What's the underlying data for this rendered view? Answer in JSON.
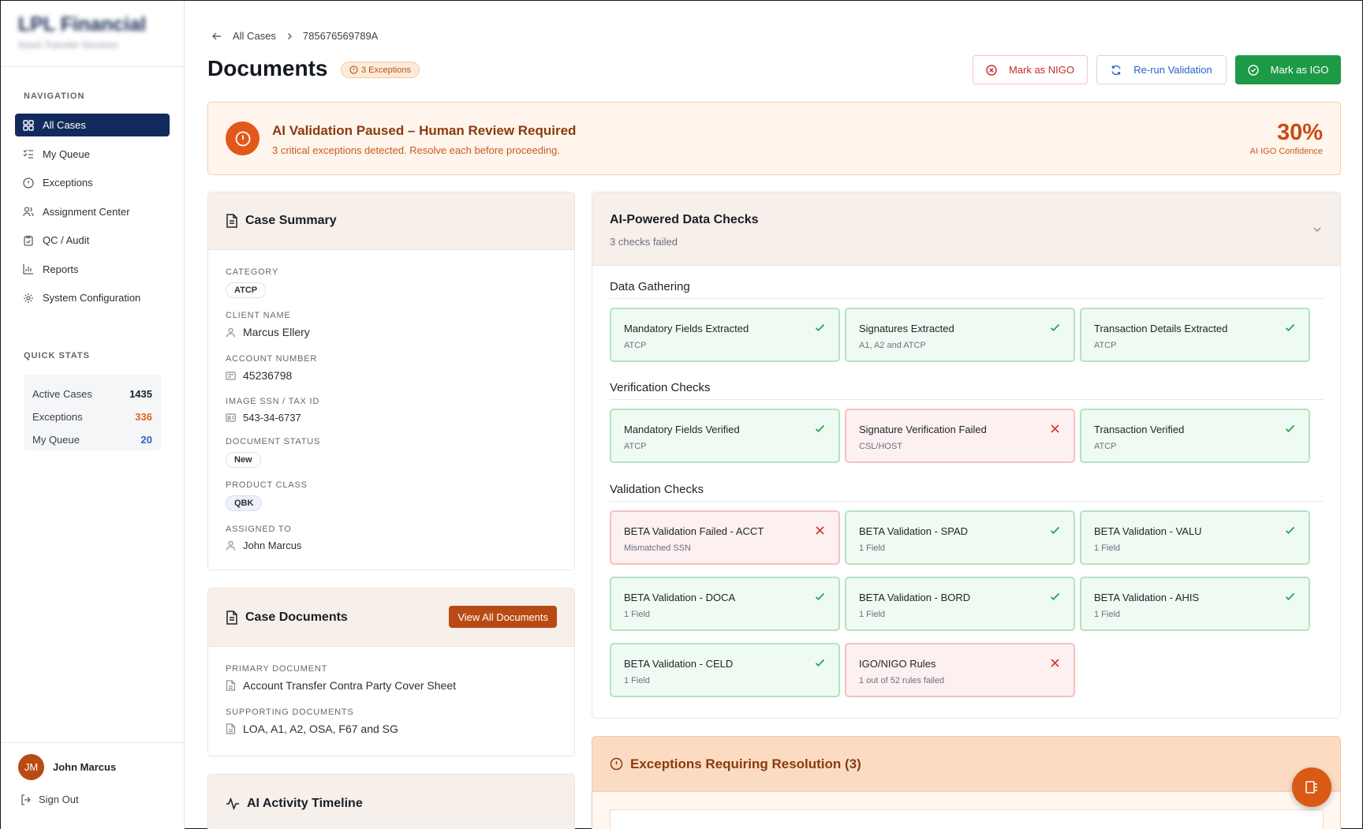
{
  "sidebar": {
    "brand_name": "LPL Financial",
    "brand_sub": "Asset Transfer Services",
    "nav_label": "NAVIGATION",
    "nav": [
      {
        "label": "All Cases",
        "icon": "grid-icon"
      },
      {
        "label": "My Queue",
        "icon": "list-check-icon"
      },
      {
        "label": "Exceptions",
        "icon": "alert-circle-icon"
      },
      {
        "label": "Assignment Center",
        "icon": "users-icon"
      },
      {
        "label": "QC / Audit",
        "icon": "clipboard-check-icon"
      },
      {
        "label": "Reports",
        "icon": "bar-chart-icon"
      },
      {
        "label": "System Configuration",
        "icon": "gear-icon"
      }
    ],
    "quick_stats_label": "QUICK STATS",
    "stats": [
      {
        "label": "Active Cases",
        "value": "1435",
        "color": "#1f2328"
      },
      {
        "label": "Exceptions",
        "value": "336",
        "color": "#e0651e"
      },
      {
        "label": "My Queue",
        "value": "20",
        "color": "#2d63c8"
      }
    ],
    "user": {
      "initials": "JM",
      "name": "John Marcus"
    },
    "sign_out": "Sign Out"
  },
  "breadcrumb": {
    "back": "All Cases",
    "current": "785676569789A"
  },
  "page": {
    "title": "Documents",
    "exceptions_badge": "3 Exceptions"
  },
  "actions": {
    "nigo": "Mark as NIGO",
    "rerun": "Re-run Validation",
    "igo": "Mark as IGO"
  },
  "alert": {
    "title": "AI Validation Paused – Human Review Required",
    "text": "3 critical exceptions detected. Resolve each before proceeding.",
    "confidence": "30%",
    "confidence_label": "AI IGO Confidence"
  },
  "summary": {
    "title": "Case Summary",
    "category_label": "CATEGORY",
    "category": "ATCP",
    "client_label": "CLIENT NAME",
    "client": "Marcus Ellery",
    "account_label": "ACCOUNT NUMBER",
    "account": "45236798",
    "ssn_label": "IMAGE SSN / TAX ID",
    "ssn": "543-34-6737",
    "status_label": "DOCUMENT STATUS",
    "status": "New",
    "product_label": "PRODUCT CLASS",
    "product": "QBK",
    "assigned_label": "ASSIGNED TO",
    "assigned": "John Marcus"
  },
  "documents": {
    "title": "Case Documents",
    "view_all": "View All Documents",
    "primary_label": "PRIMARY DOCUMENT",
    "primary": "Account Transfer Contra Party Cover Sheet",
    "supporting_label": "SUPPORTING DOCUMENTS",
    "supporting": "LOA, A1, A2, OSA, F67 and SG"
  },
  "timeline": {
    "title": "AI Activity Timeline"
  },
  "checks": {
    "title": "AI-Powered Data Checks",
    "subtitle": "3 checks failed",
    "sections": [
      {
        "title": "Data Gathering",
        "items": [
          {
            "name": "Mandatory Fields Extracted",
            "desc": "ATCP",
            "status": "pass"
          },
          {
            "name": "Signatures Extracted",
            "desc": "A1, A2 and ATCP",
            "status": "pass"
          },
          {
            "name": "Transaction Details Extracted",
            "desc": "ATCP",
            "status": "pass"
          }
        ]
      },
      {
        "title": "Verification Checks",
        "items": [
          {
            "name": "Mandatory Fields Verified",
            "desc": "ATCP",
            "status": "pass"
          },
          {
            "name": "Signature Verification Failed",
            "desc": "CSL/HOST",
            "status": "fail"
          },
          {
            "name": "Transaction Verified",
            "desc": "ATCP",
            "status": "pass"
          }
        ]
      },
      {
        "title": "Validation Checks",
        "items": [
          {
            "name": "BETA Validation Failed - ACCT",
            "desc": "Mismatched SSN",
            "status": "fail"
          },
          {
            "name": "BETA Validation - SPAD",
            "desc": "1 Field",
            "status": "pass"
          },
          {
            "name": "BETA Validation - VALU",
            "desc": "1 Field",
            "status": "pass"
          },
          {
            "name": "BETA Validation - DOCA",
            "desc": "1 Field",
            "status": "pass"
          },
          {
            "name": "BETA Validation - BORD",
            "desc": "1 Field",
            "status": "pass"
          },
          {
            "name": "BETA Validation - AHIS",
            "desc": "1 Field",
            "status": "pass"
          },
          {
            "name": "BETA Validation - CELD",
            "desc": "1 Field",
            "status": "pass"
          },
          {
            "name": "IGO/NIGO Rules",
            "desc": "1 out of 52 rules failed",
            "status": "fail"
          }
        ]
      }
    ]
  },
  "exceptions_panel": {
    "title": "Exceptions Requiring Resolution (3)"
  }
}
